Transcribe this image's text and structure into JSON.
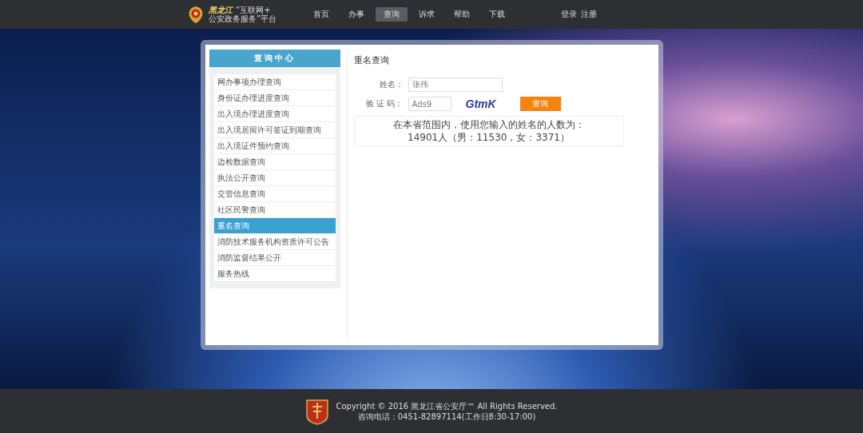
{
  "header": {
    "logo": {
      "province": "黑龙江",
      "line_1": "“互联网+",
      "line_2": "公安政务服务”平台"
    },
    "nav": [
      {
        "label": "首页",
        "selected": false
      },
      {
        "label": "办事",
        "selected": false
      },
      {
        "label": "查询",
        "selected": true
      },
      {
        "label": "诉求",
        "selected": false
      },
      {
        "label": "帮助",
        "selected": false
      },
      {
        "label": "下载",
        "selected": false
      }
    ],
    "account": [
      "登录",
      "注册"
    ]
  },
  "sidebar": {
    "title": "查询中心",
    "items": [
      {
        "label": "网办事项办理查询",
        "selected": false
      },
      {
        "label": "身份证办理进度查询",
        "selected": false
      },
      {
        "label": "出入境办理进度查询",
        "selected": false
      },
      {
        "label": "出入境居留许可签证到期查询",
        "selected": false
      },
      {
        "label": "出入境证件预约查询",
        "selected": false
      },
      {
        "label": "边检数据查询",
        "selected": false
      },
      {
        "label": "执法公开查询",
        "selected": false
      },
      {
        "label": "交管信息查询",
        "selected": false
      },
      {
        "label": "社区民警查询",
        "selected": false
      },
      {
        "label": "重名查询",
        "selected": true
      },
      {
        "label": "消防技术服务机构资质许可公告",
        "selected": false
      },
      {
        "label": "消防监督结果公开",
        "selected": false
      },
      {
        "label": "服务热线",
        "selected": false
      }
    ]
  },
  "main": {
    "title": "重名查询",
    "form": {
      "name_label": "姓名：",
      "name_value": "张伟",
      "code_label": "验 证 码：",
      "code_value": "Ads9",
      "captcha": "GtmK",
      "button": "查询"
    },
    "result": {
      "line_1": "在本省范围内，使用您输入的姓名的人数为：",
      "line_2": "14901人（男：11530，女：3371）"
    }
  },
  "footer": {
    "copyright": "Copyright © 2016 黑龙江省公安厅™ All Rights Reserved.",
    "phone": "咨询电话：0451-82897114(工作日8:30-17:00)"
  }
}
